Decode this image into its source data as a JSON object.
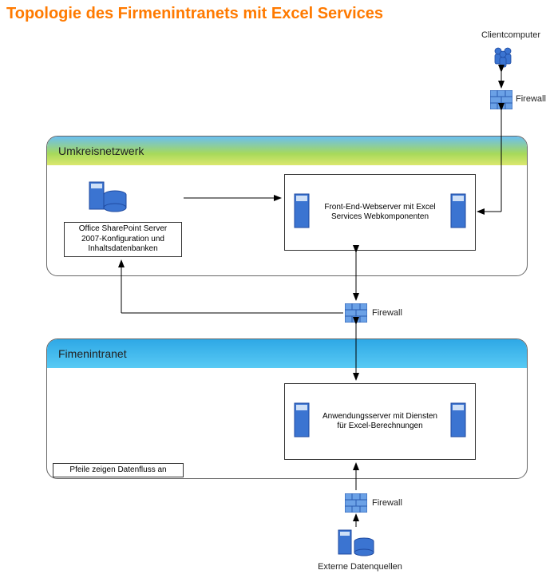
{
  "title": "Topologie des Firmenintranets mit Excel Services",
  "zones": {
    "perimeter": {
      "label": "Umkreisnetzwerk"
    },
    "intranet": {
      "label": "Fimenintranet"
    }
  },
  "nodes": {
    "client": {
      "label": "Clientcomputer"
    },
    "firewall_top": {
      "label": "Firewall"
    },
    "sharepoint": {
      "label": "Office SharePoint Server 2007-Konfiguration und Inhaltsdatenbanken"
    },
    "frontend": {
      "label": "Front-End-Webserver mit Excel Services Webkomponenten"
    },
    "firewall_mid": {
      "label": "Firewall"
    },
    "appserver": {
      "label": "Anwendungsserver mit Diensten für Excel-Berechnungen"
    },
    "firewall_bot": {
      "label": "Firewall"
    },
    "external_ds": {
      "label": "Externe Datenquellen"
    }
  },
  "footnote": "Pfeile zeigen Datenfluss an",
  "colors": {
    "accent_blue": "#2f63c2",
    "title_orange": "#ff7a00"
  }
}
